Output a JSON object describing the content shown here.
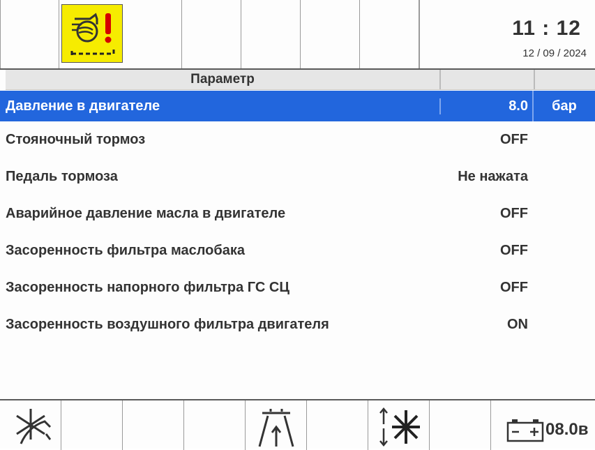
{
  "clock": {
    "time": "11 : 12",
    "date": "12 / 09 / 2024"
  },
  "table": {
    "header": "Параметр",
    "rows": [
      {
        "name": "Давление в двигателе",
        "value": "8.0",
        "unit": "бар",
        "selected": true
      },
      {
        "name": "Стояночный тормоз",
        "value": "OFF",
        "unit": ""
      },
      {
        "name": "Педаль тормоза",
        "value": "Не нажата",
        "unit": ""
      },
      {
        "name": "Аварийное давление масла в двигателе",
        "value": "OFF",
        "unit": ""
      },
      {
        "name": "Засоренность фильтра маслобака",
        "value": "OFF",
        "unit": ""
      },
      {
        "name": "Засоренность напорного фильтра ГС СЦ",
        "value": "OFF",
        "unit": ""
      },
      {
        "name": "Засоренность воздушного фильтра двигателя",
        "value": "ON",
        "unit": ""
      }
    ]
  },
  "battery": {
    "value": "08.0в"
  },
  "icons": {
    "top_warning": "engine-air-filter-warning-icon",
    "bottom_1": "fan-heating-icon",
    "bottom_2": "road-lane-icon",
    "bottom_3": "fan-updown-icon",
    "bottom_battery": "battery-icon"
  },
  "colors": {
    "selected_row": "#2266dd",
    "warning_bg": "#f6ec00"
  }
}
